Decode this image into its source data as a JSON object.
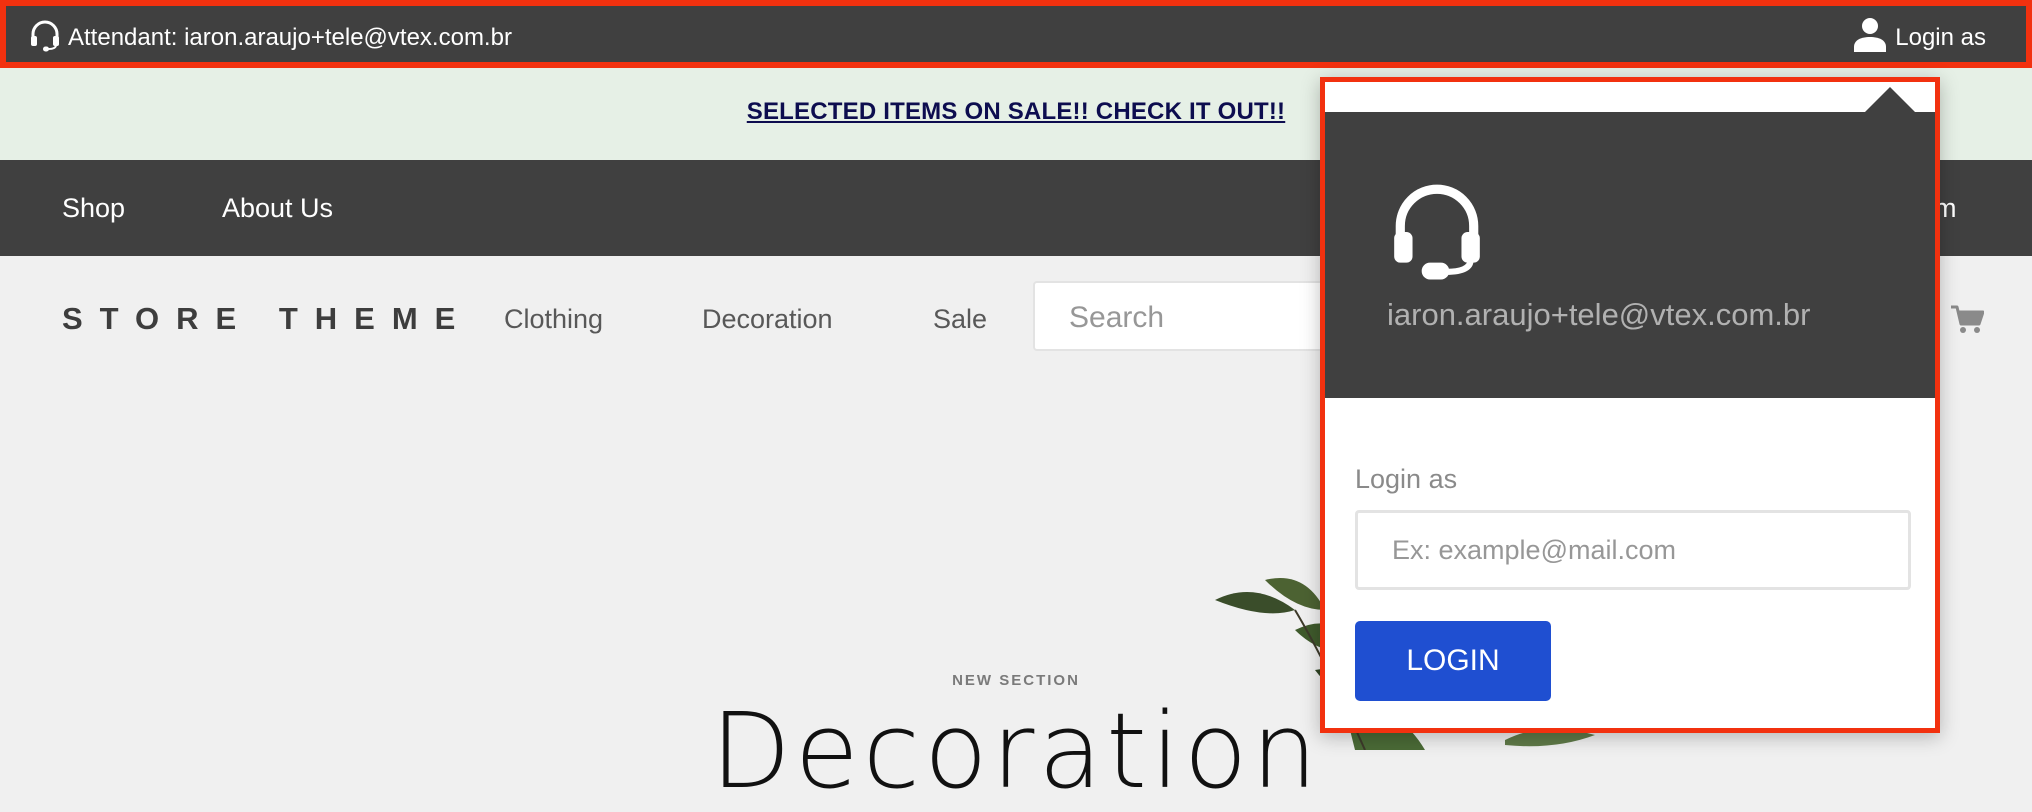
{
  "tele_bar": {
    "attendant_label": "Attendant: iaron.araujo+tele@vtex.com.br",
    "login_as_label": "Login as",
    "icons": {
      "left": "headset-icon",
      "right": "user-icon"
    },
    "bg_color": "#404040",
    "highlight_color": "#f2310f"
  },
  "promo": {
    "text": "SELECTED ITEMS ON SALE!! CHECK IT OUT!!",
    "bg_color": "#e6f0e6"
  },
  "main_nav": {
    "items": [
      "Shop",
      "About Us"
    ],
    "partial_right_item": "m"
  },
  "store_header": {
    "logo": "STORE THEME",
    "categories": [
      "Clothing",
      "Decoration",
      "Sale"
    ],
    "search_placeholder": "Search",
    "cart_icon": "cart-icon"
  },
  "hero": {
    "eyebrow": "NEW SECTION",
    "title": "Decoration"
  },
  "popover": {
    "attendant_email": "iaron.araujo+tele@vtex.com.br",
    "field_label": "Login as",
    "email_placeholder": "Ex: example@mail.com",
    "login_button": "LOGIN",
    "button_color": "#1f4fd1"
  }
}
